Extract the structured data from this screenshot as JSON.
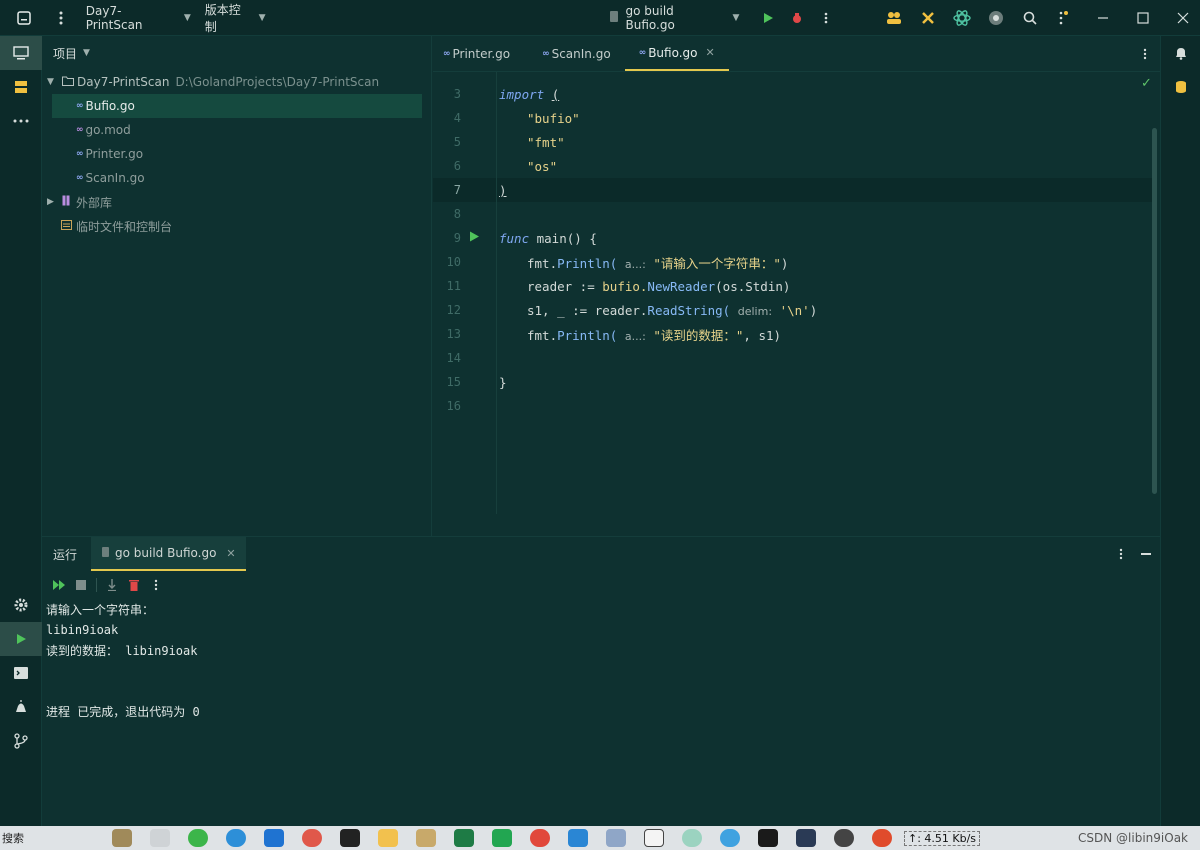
{
  "titlebar": {
    "project_name": "Day7-PrintScan",
    "vcs_label": "版本控制",
    "run_config": "go build Bufio.go"
  },
  "project_panel": {
    "title": "项目",
    "root_name": "Day7-PrintScan",
    "root_path": "D:\\GolandProjects\\Day7-PrintScan",
    "files": [
      "Bufio.go",
      "go.mod",
      "Printer.go",
      "ScanIn.go"
    ],
    "external_libs": "外部库",
    "scratches": "临时文件和控制台"
  },
  "editor": {
    "tabs": [
      "Printer.go",
      "ScanIn.go",
      "Bufio.go"
    ],
    "active_tab": "Bufio.go",
    "line_numbers": [
      "3",
      "4",
      "5",
      "6",
      "7",
      "8",
      "9",
      "10",
      "11",
      "12",
      "13",
      "14",
      "15",
      "16"
    ],
    "code": {
      "import_kw": "import",
      "import_paren": "(",
      "pkg_bufio": "\"bufio\"",
      "pkg_fmt": "\"fmt\"",
      "pkg_os": "\"os\"",
      "close_paren": ")",
      "func_kw": "func",
      "main_sig": " main() {",
      "l10_fmt": "fmt.",
      "l10_fn": "Println(",
      "l10_hint": "a...:",
      "l10_str": "\"请输入一个字符串：\"",
      "l10_end": ")",
      "l11_a": "reader := ",
      "l11_b": "bufio.",
      "l11_fn": "NewReader",
      "l11_c": "(os.Stdin)",
      "l12_a": "s1, _ := reader.",
      "l12_fn": "ReadString(",
      "l12_hint": "delim:",
      "l12_str": "'\\n'",
      "l12_end": ")",
      "l13_fmt": "fmt.",
      "l13_fn": "Println(",
      "l13_hint": "a...:",
      "l13_str": "\"读到的数据：\"",
      "l13_end": ", s1)",
      "close_brace": "}"
    }
  },
  "run_panel": {
    "label": "运行",
    "tab": "go build Bufio.go",
    "console": [
      "请输入一个字符串：",
      "libin9ioak",
      "读到的数据： libin9ioak",
      "",
      "",
      "进程 已完成，退出代码为 0"
    ]
  },
  "taskbar": {
    "search": "搜索",
    "net_speed": "↑: 4.51 Kb/s",
    "watermark": "CSDN @libin9iOak"
  },
  "colors": {
    "background": "#0e3130",
    "accent": "#e3c84e",
    "keyword": "#7fa7f0",
    "string": "#e6d28a",
    "run_green": "#4fc35b",
    "debug_red": "#e04848"
  }
}
